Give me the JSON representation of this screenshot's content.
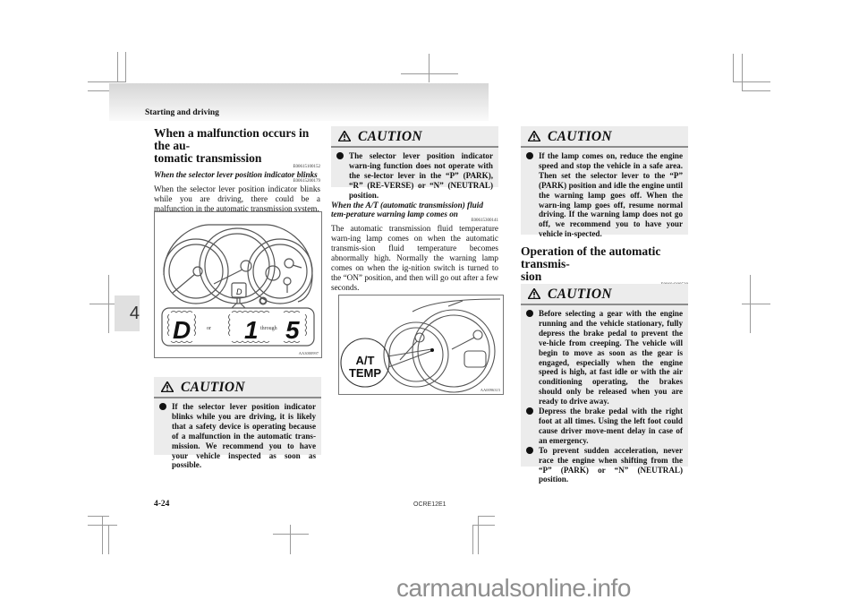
{
  "header": {
    "section": "Starting and driving"
  },
  "chapter_tab": "4",
  "left_column": {
    "title": "When a malfunction occurs in the au-tomatic transmission",
    "title_line1": "When a malfunction occurs in the au-",
    "title_line2": "tomatic transmission",
    "title_code": "E00615100152",
    "subheading": "When the selector lever position indicator blinks",
    "subheading_code": "E00615200179",
    "body": "When the selector lever position indicator blinks while you are driving, there could be a malfunction in the automatic transmission system.",
    "figure": {
      "indicator_symbol": "D",
      "display_left": "D",
      "connector_or": "or",
      "display_middle": "1",
      "connector_through": "through",
      "display_right": "5",
      "code": "AA3000997"
    },
    "caution": {
      "title": "CAUTION",
      "items": [
        "If the selector lever position indicator blinks while you are driving, it is likely that a safety device is operating because of a malfunction in the automatic trans-mission. We recommend you to have your vehicle inspected as soon as possible."
      ]
    }
  },
  "middle_column": {
    "caution": {
      "title": "CAUTION",
      "items": [
        "The selector lever position indicator warn-ing function does not operate with the se-lector lever in the “P” (PARK), “R” (RE-VERSE) or “N” (NEUTRAL) position."
      ]
    },
    "subheading": "When the A/T (automatic transmission) fluid tem-perature warning lamp comes on",
    "subheading_code": "E00615300141",
    "body": "The automatic transmission fluid temperature warn-ing lamp comes on when the automatic transmis-sion fluid temperature becomes abnormally high. Normally the warning lamp comes on when the ig-nition switch is turned to the “ON” position, and then will go out after a few seconds.",
    "figure": {
      "label_line1": "A/T",
      "label_line2": "TEMP",
      "code": "AA0096315"
    }
  },
  "right_column": {
    "caution1": {
      "title": "CAUTION",
      "items": [
        "If the lamp comes on, reduce the engine speed and stop the vehicle in a safe area. Then set the selector lever to the “P” (PARK) position and idle the engine until the warning lamp goes off. When the warn-ing lamp goes off, resume normal driving. If the warning lamp does not go off, we recommend you to have your vehicle in-spected."
      ]
    },
    "heading": "Operation of the automatic transmis-sion",
    "heading_line1": "Operation of the automatic transmis-",
    "heading_line2": "sion",
    "heading_code": "E00604200528",
    "caution2": {
      "title": "CAUTION",
      "items": [
        "Before selecting a gear with the engine running and the vehicle stationary, fully depress the brake pedal to prevent the ve-hicle from creeping. The vehicle will begin to move as soon as the gear is engaged, especially when the engine speed is high, at fast idle or with the air conditioning operating, the brakes should only be released when you are ready to drive away.",
        "Depress the brake pedal with the right foot at all times. Using the left foot could cause driver move-ment delay in case of an emergency.",
        "To prevent sudden acceleration, never race the engine when shifting from the “P” (PARK) or “N” (NEUTRAL) position."
      ]
    }
  },
  "footer": {
    "page_number": "4-24",
    "doc_code": "OCRE12E1"
  },
  "watermark": "carmanualsonline.info"
}
